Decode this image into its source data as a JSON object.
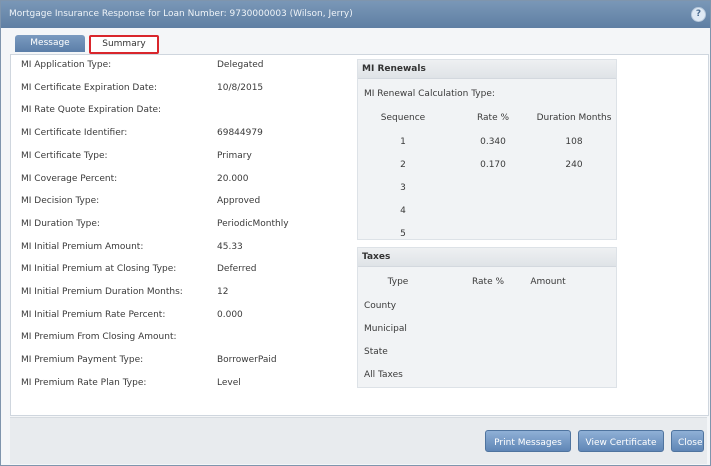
{
  "window": {
    "title": "Mortgage Insurance Response for Loan Number: 9730000003 (Wilson, Jerry)",
    "help_label": "?"
  },
  "tabs": [
    {
      "label": "Message"
    },
    {
      "label": "Summary"
    }
  ],
  "fields": [
    {
      "label": "MI Application Type:",
      "value": "Delegated"
    },
    {
      "label": "MI Certificate Expiration Date:",
      "value": "10/8/2015"
    },
    {
      "label": "MI Rate Quote Expiration Date:",
      "value": ""
    },
    {
      "label": "MI Certificate Identifier:",
      "value": "69844979"
    },
    {
      "label": "MI Certificate Type:",
      "value": "Primary"
    },
    {
      "label": "MI Coverage Percent:",
      "value": "20.000"
    },
    {
      "label": "MI Decision Type:",
      "value": "Approved"
    },
    {
      "label": "MI Duration Type:",
      "value": "PeriodicMonthly"
    },
    {
      "label": "MI Initial Premium Amount:",
      "value": "45.33"
    },
    {
      "label": "MI Initial Premium at Closing Type:",
      "value": "Deferred"
    },
    {
      "label": "MI Initial Premium Duration Months:",
      "value": "12"
    },
    {
      "label": "MI Initial Premium Rate Percent:",
      "value": "0.000"
    },
    {
      "label": "MI Premium From Closing Amount:",
      "value": ""
    },
    {
      "label": "MI Premium Payment Type:",
      "value": "BorrowerPaid"
    },
    {
      "label": "MI Premium Rate Plan Type:",
      "value": "Level"
    }
  ],
  "renewals": {
    "header": "MI Renewals",
    "subtitle": "MI Renewal Calculation Type:",
    "columns": [
      "Sequence",
      "Rate %",
      "Duration Months"
    ],
    "rows": [
      {
        "sequence": "1",
        "rate": "0.340",
        "months": "108"
      },
      {
        "sequence": "2",
        "rate": "0.170",
        "months": "240"
      },
      {
        "sequence": "3",
        "rate": "",
        "months": ""
      },
      {
        "sequence": "4",
        "rate": "",
        "months": ""
      },
      {
        "sequence": "5",
        "rate": "",
        "months": ""
      }
    ]
  },
  "taxes": {
    "header": "Taxes",
    "columns": [
      "Type",
      "Rate %",
      "Amount"
    ],
    "rows": [
      "County",
      "Municipal",
      "State",
      "All Taxes"
    ]
  },
  "buttons": {
    "print": "Print Messages",
    "view_certificate": "View Certificate",
    "close": "Close"
  }
}
